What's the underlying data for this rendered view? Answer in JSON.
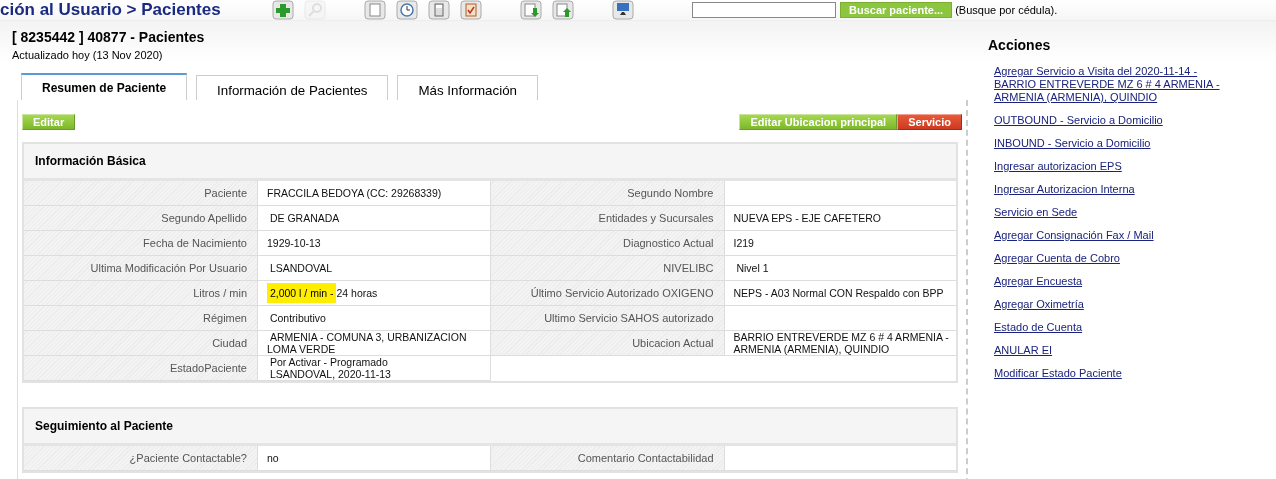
{
  "topbar": {
    "breadcrumb": "ción al Usuario > Pacientes",
    "search": {
      "button": "Buscar paciente...",
      "hint": "(Busque por cédula)."
    },
    "tools": [
      {
        "disabled": false
      },
      {
        "disabled": true
      },
      {
        "disabled": false
      },
      {
        "disabled": false
      },
      {
        "disabled": false
      },
      {
        "disabled": false
      },
      {
        "disabled": false
      },
      {
        "disabled": false
      },
      {
        "disabled": false
      }
    ]
  },
  "title": "[ 8235442 ] 40877 - Pacientes",
  "subtitle": "Actualizado hoy (13 Nov 2020)",
  "tabs": [
    {
      "label": "Resumen de Paciente",
      "selected": true
    },
    {
      "label": "Información de Pacientes",
      "selected": false
    },
    {
      "label": "Más Información",
      "selected": false
    }
  ],
  "buttons": [
    {
      "label": "Editar",
      "kind": "green"
    },
    {
      "label": "Editar Ubicacion principal",
      "kind": "green"
    },
    {
      "label": "Servicio",
      "kind": "red"
    }
  ],
  "basic_info": {
    "title": "Información Básica",
    "left": [
      {
        "label": "Paciente",
        "value": "FRACCILA BEDOYA (CC: 29268339)"
      },
      {
        "label": "Segundo Apellido",
        "value": " DE GRANADA"
      },
      {
        "label": "Fecha de Nacimiento",
        "value": "1929-10-13"
      },
      {
        "label": "Ultima Modificación Por Usuario",
        "value": " LSANDOVAL"
      },
      {
        "label": "Litros / min",
        "highlighted": " 2,000 l / min - ",
        "value": "24 horas"
      },
      {
        "label": "Régimen",
        "value": " Contributivo"
      },
      {
        "label": "Ciudad",
        "value": " ARMENIA - COMUNA 3, URBANIZACION LOMA VERDE"
      },
      {
        "label": "EstadoPaciente",
        "value": " Por Activar - Programado\n LSANDOVAL, 2020-11-13"
      }
    ],
    "right": [
      {
        "label": "Segundo Nombre"
      },
      {
        "label": "Entidades y Sucursales",
        "value": "NUEVA EPS - EJE CAFETERO"
      },
      {
        "label": "Diagnostico Actual",
        "value": "I219"
      },
      {
        "label": "NIVELIBC",
        "value": " Nivel 1"
      },
      {
        "label": "Último Servicio Autorizado OXIGENO",
        "value": "NEPS - A03 Normal CON Respaldo con BPP"
      },
      {
        "label": "Ultimo Servicio SAHOS autorizado"
      },
      {
        "label": "Ubicacion Actual",
        "value": "BARRIO ENTREVERDE MZ 6 # 4 ARMENIA - ARMENIA (ARMENIA), QUINDIO"
      }
    ]
  },
  "follow_up": {
    "title": "Seguimiento al Paciente",
    "left": [
      {
        "label": "¿Paciente Contactable?",
        "value": "no"
      }
    ],
    "right": [
      {
        "label": "Comentario Contactabilidad"
      }
    ]
  },
  "actions": {
    "title": "Acciones",
    "links": [
      "Agregar Servicio a Visita del 2020-11-14 - BARRIO ENTREVERDE MZ 6 # 4 ARMENIA - ARMENIA (ARMENIA), QUINDIO",
      "OUTBOUND - Servicio a Domicilio",
      "INBOUND - Servicio a Domicilio",
      "Ingresar autorizacion EPS",
      "Ingresar Autorizacion Interna",
      "Servicio en Sede",
      "Agregar Consignación Fax / Mail",
      "Agregar Cuenta de Cobro",
      "Agregar Encuesta",
      "Agregar Oximetría",
      "Estado de Cuenta",
      "ANULAR EI",
      "Modificar Estado Paciente"
    ]
  }
}
